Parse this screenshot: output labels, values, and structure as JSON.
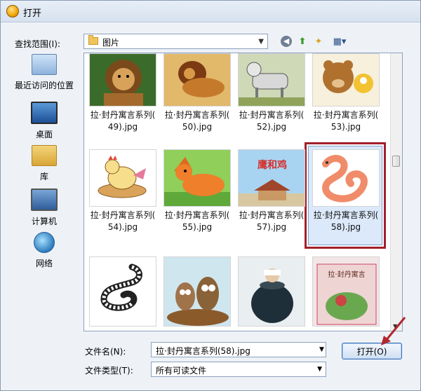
{
  "window": {
    "title": "打开"
  },
  "toolbar": {
    "look_in_label": "查找范围(I):",
    "look_in_value": "图片"
  },
  "places": [
    {
      "label": "最近访问的位置",
      "icon": "recent-places-icon"
    },
    {
      "label": "桌面",
      "icon": "desktop-icon"
    },
    {
      "label": "库",
      "icon": "library-icon"
    },
    {
      "label": "计算机",
      "icon": "computer-icon"
    },
    {
      "label": "网络",
      "icon": "network-icon"
    }
  ],
  "files": [
    {
      "line1": "拉·封丹寓言系列(",
      "line2": "49).jpg",
      "art": "lion"
    },
    {
      "line1": "拉·封丹寓言系列(",
      "line2": "50).jpg",
      "art": "lion2"
    },
    {
      "line1": "拉·封丹寓言系列(",
      "line2": "52).jpg",
      "art": "donkey"
    },
    {
      "line1": "拉·封丹寓言系列(",
      "line2": "53).jpg",
      "art": "bear"
    },
    {
      "line1": "拉·封丹寓言系列(",
      "line2": "54).jpg",
      "art": "hen"
    },
    {
      "line1": "拉·封丹寓言系列(",
      "line2": "55).jpg",
      "art": "fox"
    },
    {
      "line1": "拉·封丹寓言系列(",
      "line2": "57).jpg",
      "art": "house",
      "banner": "鹰和鸡"
    },
    {
      "line1": "拉·封丹寓言系列(",
      "line2": "58).jpg",
      "art": "snake",
      "selected": true
    },
    {
      "line1": "",
      "line2": "",
      "art": "snake-outline"
    },
    {
      "line1": "",
      "line2": "",
      "art": "owls"
    },
    {
      "line1": "",
      "line2": "",
      "art": "jar"
    },
    {
      "line1": "",
      "line2": "",
      "art": "book",
      "banner": "拉·封丹寓言"
    }
  ],
  "footer": {
    "file_name_label": "文件名(N):",
    "file_name_value": "拉·封丹寓言系列(58).jpg",
    "file_type_label": "文件类型(T):",
    "file_type_value": "所有可读文件",
    "open_label": "打开(O)"
  },
  "colors": {
    "selection_frame": "#a1202a",
    "annotation_arrow": "#b3262d"
  }
}
